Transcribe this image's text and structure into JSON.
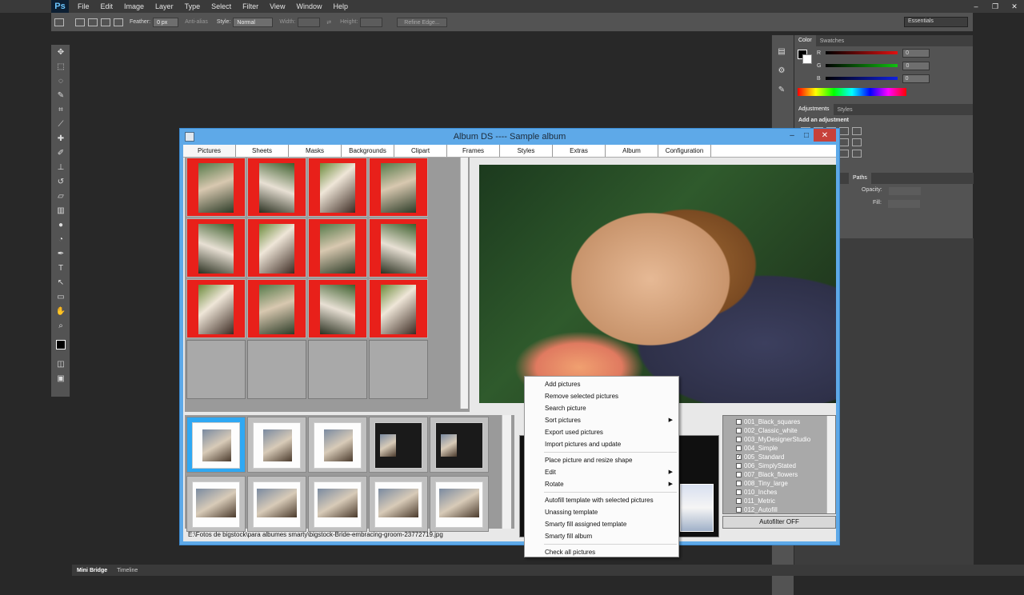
{
  "ps": {
    "logo": "Ps",
    "menu": [
      "File",
      "Edit",
      "Image",
      "Layer",
      "Type",
      "Select",
      "Filter",
      "View",
      "Window",
      "Help"
    ],
    "window_controls": [
      "–",
      "❐",
      "✕"
    ],
    "options": {
      "feather_label": "Feather:",
      "feather_value": "0 px",
      "antialias_label": "Anti-alias",
      "style_label": "Style:",
      "style_value": "Normal",
      "width_label": "Width:",
      "height_label": "Height:",
      "refine_edge": "Refine Edge...",
      "workspace": "Essentials"
    },
    "color_panel": {
      "tabs": [
        "Color",
        "Swatches"
      ],
      "channels": [
        {
          "label": "R",
          "value": "0",
          "color": "#e01010"
        },
        {
          "label": "G",
          "value": "0",
          "color": "#10c010"
        },
        {
          "label": "B",
          "value": "0",
          "color": "#1020e0"
        }
      ]
    },
    "adjustments": {
      "tabs": [
        "Adjustments",
        "Styles"
      ],
      "title": "Add an adjustment"
    },
    "layers": {
      "tabs": [
        "Paths"
      ],
      "opacity_label": "Opacity:",
      "fill_label": "Fill:"
    },
    "bottom_tabs": [
      "Mini Bridge",
      "Timeline"
    ]
  },
  "album": {
    "title": "Album DS  ----  Sample album",
    "window_controls": [
      "–",
      "□",
      "✕"
    ],
    "tabs": [
      "Pictures",
      "Sheets",
      "Masks",
      "Backgrounds",
      "Clipart",
      "Frames",
      "Styles",
      "Extras",
      "Album",
      "Configuration"
    ],
    "context_menu": [
      {
        "label": "Add pictures"
      },
      {
        "label": "Remove selected pictures"
      },
      {
        "label": "Search picture"
      },
      {
        "label": "Sort pictures",
        "submenu": true
      },
      {
        "label": "Export used pictures"
      },
      {
        "label": "Import pictures and update"
      },
      {
        "separator": true
      },
      {
        "label": "Place picture and resize shape"
      },
      {
        "label": "Edit",
        "submenu": true
      },
      {
        "label": "Rotate",
        "submenu": true
      },
      {
        "separator": true
      },
      {
        "label": "Autofill template with selected pictures"
      },
      {
        "label": "Unassing template"
      },
      {
        "label": "Smarty fill assigned template"
      },
      {
        "label": "Smarty fill album"
      },
      {
        "separator": true
      },
      {
        "label": "Check all pictures"
      }
    ],
    "templates": [
      {
        "name": "001_Black_squares",
        "checked": false
      },
      {
        "name": "002_Classic_white",
        "checked": false
      },
      {
        "name": "003_MyDesignerStudio",
        "checked": false
      },
      {
        "name": "004_Simple",
        "checked": false
      },
      {
        "name": "005_Standard",
        "checked": true
      },
      {
        "name": "006_SimplyStated",
        "checked": false
      },
      {
        "name": "007_Black_flowers",
        "checked": false
      },
      {
        "name": "008_Tiny_large",
        "checked": false
      },
      {
        "name": "010_Inches",
        "checked": false
      },
      {
        "name": "011_Metric",
        "checked": false
      },
      {
        "name": "012_Autofill",
        "checked": false
      }
    ],
    "autofilter": "Autofilter OFF",
    "status_path": "E:\\Fotos de bigstock\\para albumes smarty\\bigstock-Bride-embracing-groom-23772719.jpg"
  }
}
